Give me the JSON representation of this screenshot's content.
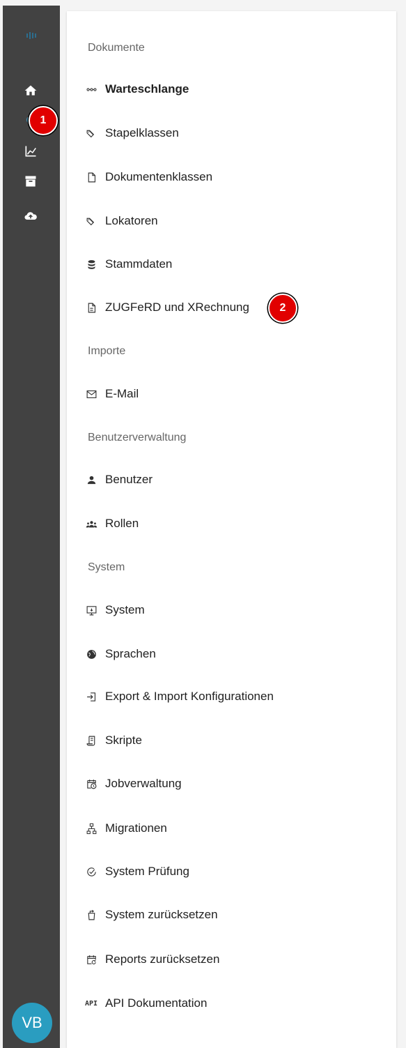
{
  "rail": {
    "icons": [
      "logo-icon",
      "home-icon",
      "gear-icon",
      "chart-icon",
      "archive-icon",
      "cloud-upload-icon"
    ],
    "avatar": "VB"
  },
  "badges": {
    "one": "1",
    "two": "2"
  },
  "menu": {
    "sections": {
      "dokumente": "Dokumente",
      "importe": "Importe",
      "benutzerverwaltung": "Benutzerverwaltung",
      "system": "System"
    },
    "items": {
      "warteschlange": "Warteschlange",
      "stapelklassen": "Stapelklassen",
      "dokumentenklassen": "Dokumentenklassen",
      "lokatoren": "Lokatoren",
      "stammdaten": "Stammdaten",
      "zugferd": "ZUGFeRD und XRechnung",
      "email": "E-Mail",
      "benutzer": "Benutzer",
      "rollen": "Rollen",
      "system": "System",
      "sprachen": "Sprachen",
      "export_import": "Export & Import Konfigurationen",
      "skripte": "Skripte",
      "jobverwaltung": "Jobverwaltung",
      "migrationen": "Migrationen",
      "system_pruefung": "System Prüfung",
      "system_reset": "System zurücksetzen",
      "reports_reset": "Reports zurücksetzen",
      "api_doku": "API Dokumentation"
    },
    "api_icon_text": "API"
  }
}
